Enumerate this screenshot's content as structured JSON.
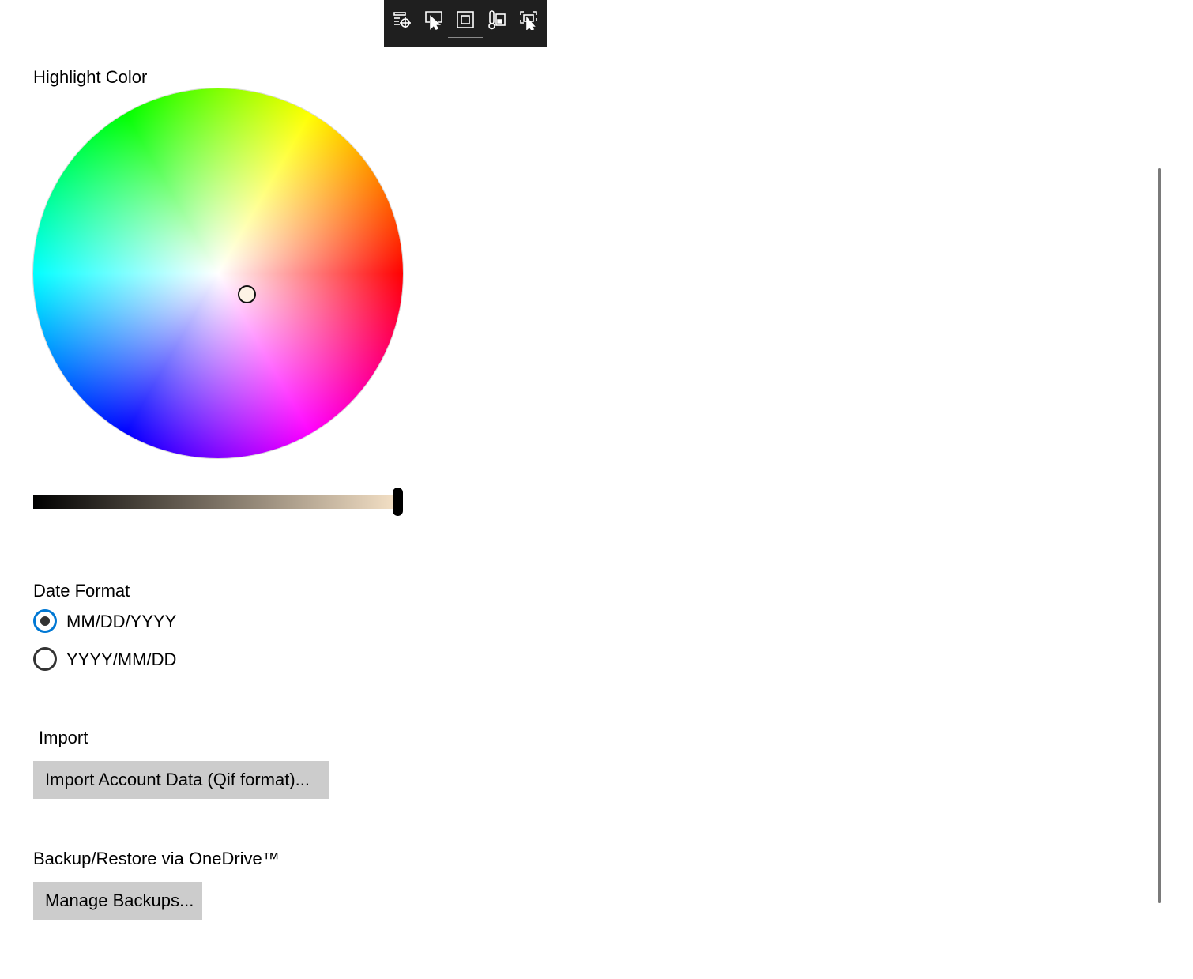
{
  "toolbar": {
    "icons": [
      "live-visual-tree-icon",
      "select-element-icon",
      "display-layout-adorners-icon",
      "track-focus-icon",
      "preview-selection-icon"
    ]
  },
  "highlight": {
    "label": "Highlight Color",
    "brightness_percent": 100
  },
  "date_format": {
    "label": "Date Format",
    "options": [
      {
        "label": "MM/DD/YYYY",
        "selected": true
      },
      {
        "label": "YYYY/MM/DD",
        "selected": false
      }
    ]
  },
  "import": {
    "label": "Import",
    "button_label": "Import Account Data (Qif format)..."
  },
  "backup": {
    "label": "Backup/Restore via OneDrive™",
    "button_label": "Manage Backups..."
  },
  "colors": {
    "accent": "#0078d4",
    "button_bg": "#cccccc",
    "toolbar_bg": "#1f1f1f"
  }
}
